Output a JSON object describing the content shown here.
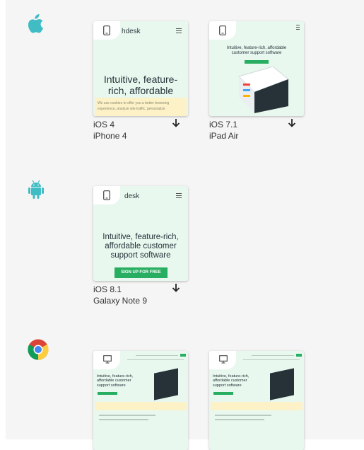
{
  "groups": [
    {
      "os": "ios",
      "icon": "apple-icon",
      "tiles": [
        {
          "brand": "hdesk",
          "hero": "Intuitive, feature-rich, affordable",
          "cookie": "We use cookies to offer you a better browsing experience, analyze site traffic, personalize",
          "os_version": "iOS 4",
          "device": "iPhone 4"
        },
        {
          "hero": "Intuitive, feature-rich, affordable customer support software",
          "os_version": "iOS 7.1",
          "device": "iPad Air"
        }
      ]
    },
    {
      "os": "android",
      "icon": "android-icon",
      "tiles": [
        {
          "brand": "desk",
          "hero": "Intuitive, feature-rich, affordable customer support software",
          "cta": "SIGN UP FOR FREE",
          "os_version": "iOS 8.1",
          "device": "Galaxy Note 9"
        }
      ]
    },
    {
      "os": "chrome",
      "icon": "chrome-icon",
      "tiles": [
        {
          "hero": "Intuitive, feature-rich, affordable customer support software"
        },
        {
          "hero": "Intuitive, feature-rich, affordable customer support software"
        }
      ]
    }
  ],
  "colors": {
    "accent": "#3fbcc4",
    "card_bg": "#e8f8ef",
    "cta": "#27ae60"
  }
}
